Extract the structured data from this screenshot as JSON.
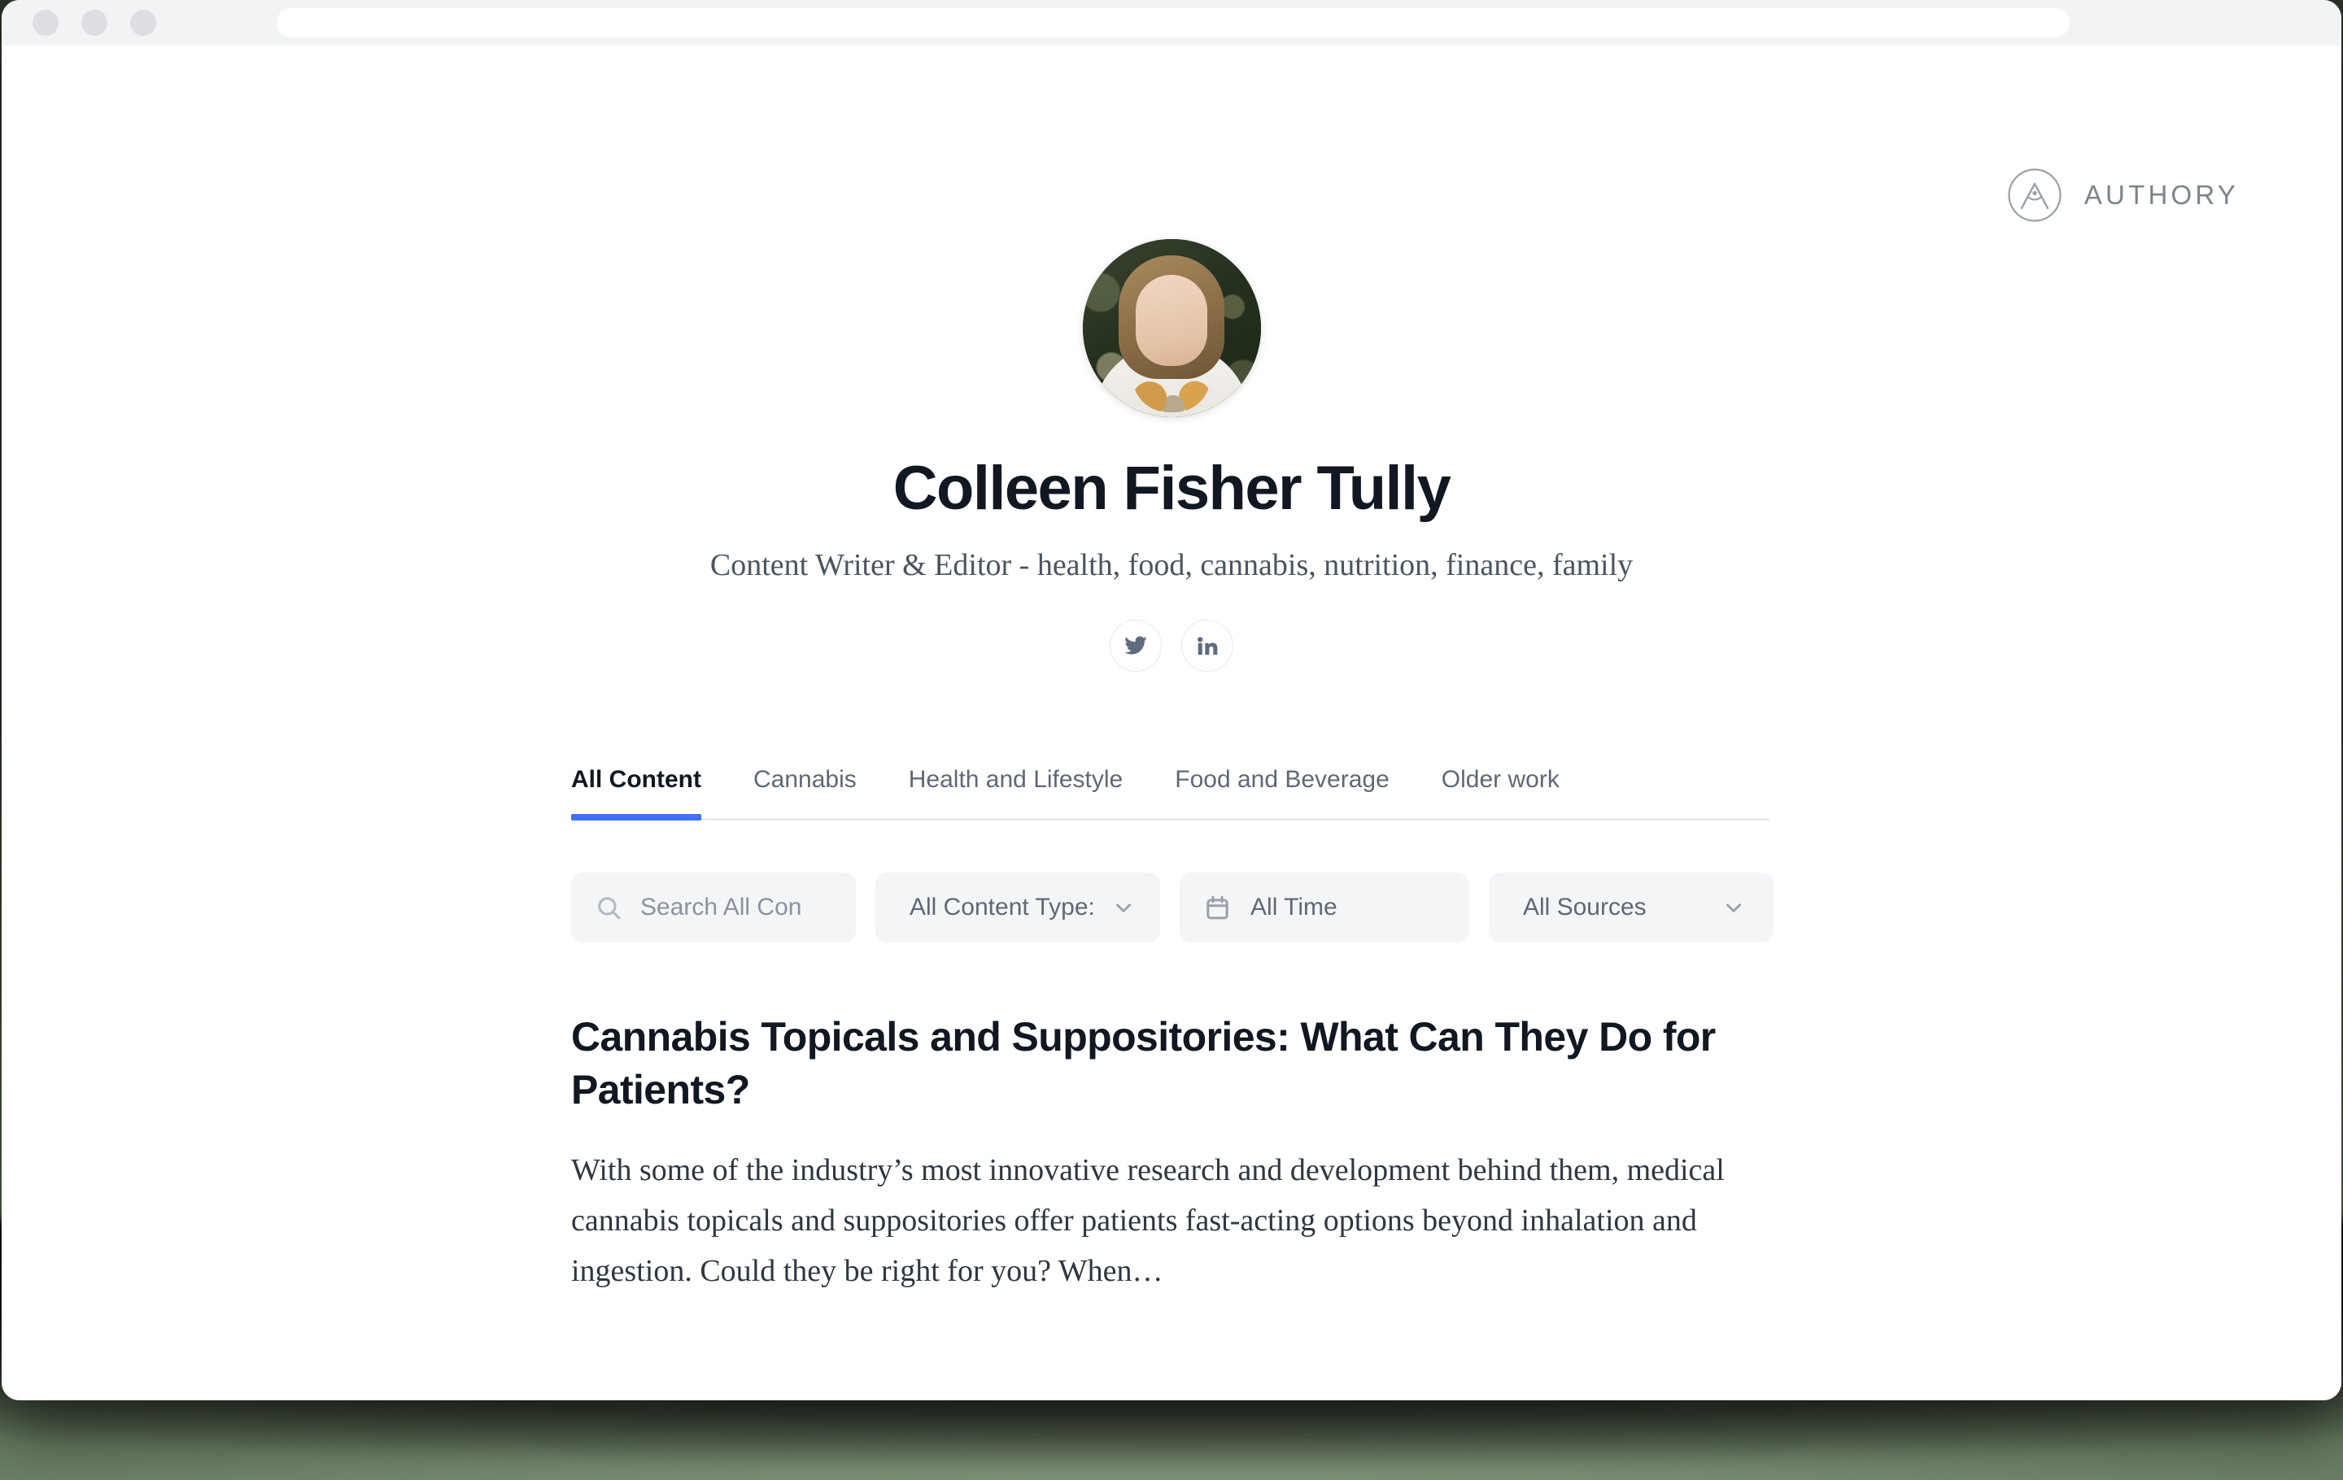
{
  "browser": {
    "traffic_lights": [
      "close",
      "minimize",
      "maximize"
    ],
    "url_value": "",
    "url_placeholder": ""
  },
  "brand": {
    "wordmark": "AUTHORY",
    "mark_icon": "authory-compass-a-icon"
  },
  "profile": {
    "avatar_alt": "Colleen Fisher Tully profile photo",
    "name": "Colleen Fisher Tully",
    "tagline": "Content Writer & Editor - health, food, cannabis, nutrition, finance, family",
    "social": [
      {
        "id": "twitter",
        "icon": "twitter-icon",
        "label": "Twitter"
      },
      {
        "id": "linkedin",
        "icon": "linkedin-icon",
        "label": "LinkedIn"
      }
    ]
  },
  "tabs": [
    {
      "label": "All Content",
      "active": true
    },
    {
      "label": "Cannabis",
      "active": false
    },
    {
      "label": "Health and Lifestyle",
      "active": false
    },
    {
      "label": "Food and Beverage",
      "active": false
    },
    {
      "label": "Older work",
      "active": false
    }
  ],
  "filters": {
    "search": {
      "icon": "search-icon",
      "placeholder": "Search All Con",
      "value": ""
    },
    "content_type": {
      "label": "All Content Type:",
      "chevron": "chevron-down-icon"
    },
    "time": {
      "icon": "calendar-icon",
      "label": "All Time"
    },
    "sources": {
      "label": "All Sources",
      "chevron": "chevron-down-icon"
    }
  },
  "articles": [
    {
      "title": "Cannabis Topicals and Suppositories: What Can They Do for Patients?",
      "excerpt": "With some of the industry’s most innovative research and development behind them, medical cannabis topicals and suppositories offer patients fast-acting options beyond inhalation and ingestion. Could they be right for you? When…"
    }
  ],
  "colors": {
    "accent_blue": "#4070f4",
    "text_dark": "#111822",
    "text_muted": "#5f6874",
    "placeholder": "#8c939e",
    "filter_bg": "#f4f5f7",
    "chrome_bg": "#f2f3f5",
    "divider": "#e8eaee",
    "backdrop_green": "#6b7f63"
  }
}
